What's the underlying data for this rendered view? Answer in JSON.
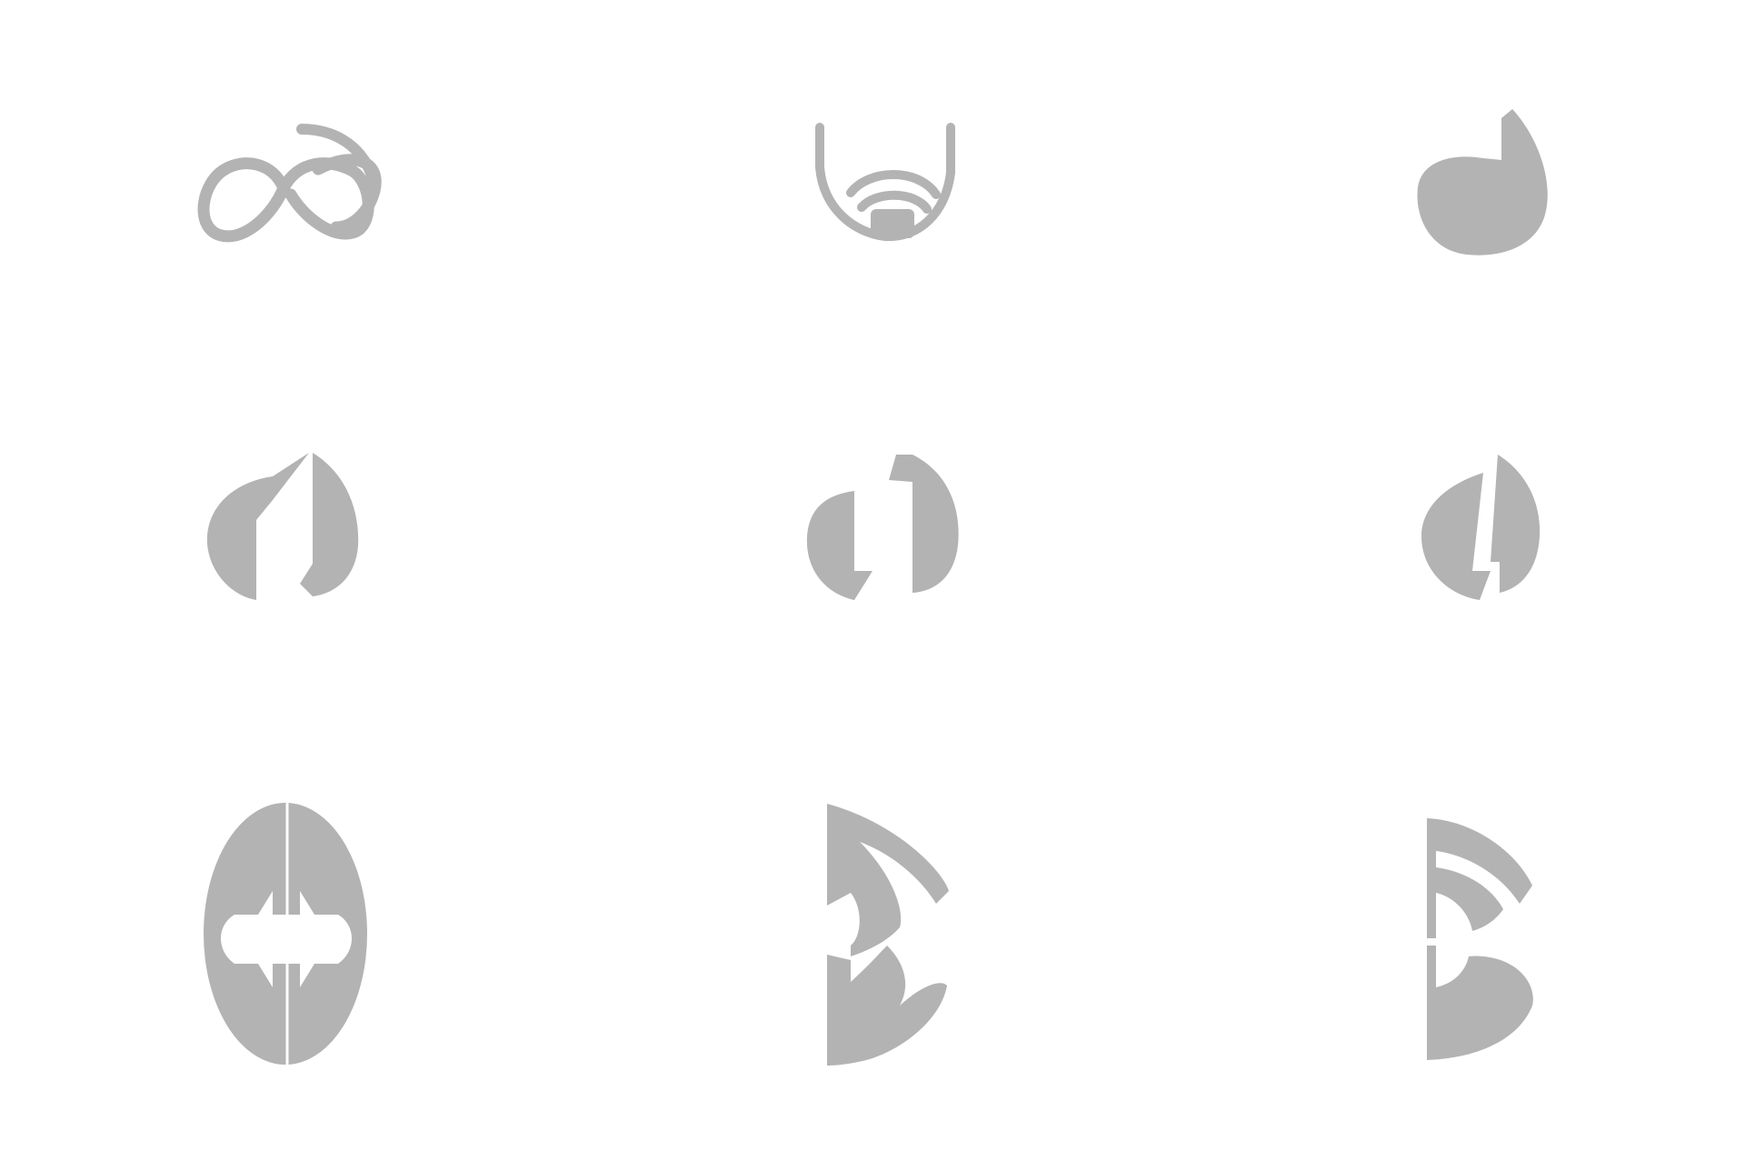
{
  "colors": {
    "background": "#ffffff",
    "glyph": "#b3b3b3"
  },
  "icons": [
    {
      "row": 1,
      "col": 1,
      "name": "infinity-loop-icon"
    },
    {
      "row": 1,
      "col": 2,
      "name": "signal-cup-icon"
    },
    {
      "row": 1,
      "col": 3,
      "name": "leaf-blob-icon"
    },
    {
      "row": 2,
      "col": 1,
      "name": "split-leaf-a-icon"
    },
    {
      "row": 2,
      "col": 2,
      "name": "split-leaf-b-icon"
    },
    {
      "row": 2,
      "col": 3,
      "name": "split-leaf-c-icon"
    },
    {
      "row": 3,
      "col": 1,
      "name": "oval-arrows-icon"
    },
    {
      "row": 3,
      "col": 2,
      "name": "half-oval-waves-icon"
    },
    {
      "row": 3,
      "col": 3,
      "name": "b-waves-icon"
    }
  ]
}
